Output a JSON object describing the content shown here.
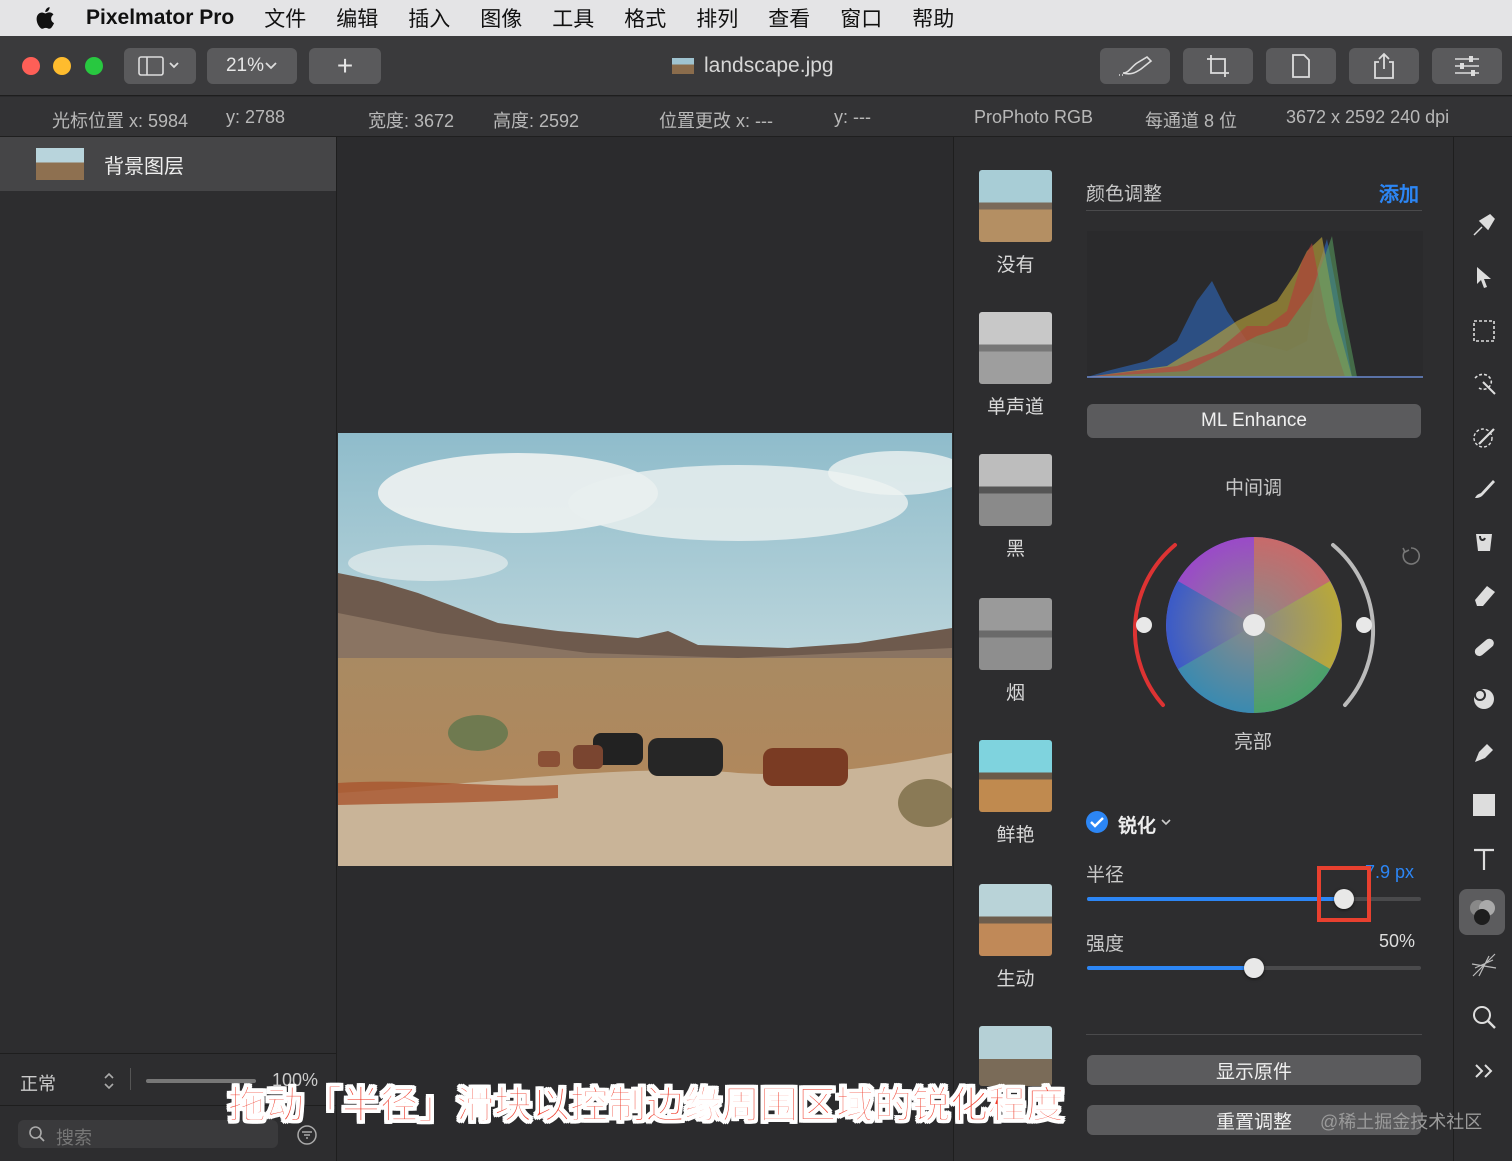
{
  "menubar": {
    "app_name": "Pixelmator Pro",
    "items": [
      "文件",
      "编辑",
      "插入",
      "图像",
      "工具",
      "格式",
      "排列",
      "查看",
      "窗口",
      "帮助"
    ]
  },
  "toolbar": {
    "zoom_label": "21%",
    "add_label": "+",
    "document_title": "landscape.jpg"
  },
  "infobar": {
    "cursor_x": "光标位置 x: 5984",
    "cursor_y": "y: 2788",
    "width": "宽度: 3672",
    "height": "高度: 2592",
    "pos_change_x": "位置更改 x: ---",
    "pos_change_y": "y: ---",
    "color_profile": "ProPhoto RGB",
    "bit_depth": "每通道 8 位",
    "dimensions": "3672 x 2592 240 dpi"
  },
  "layers": {
    "layer_name": "背景图层",
    "blend_mode": "正常",
    "opacity": "100%",
    "search_placeholder": "搜索"
  },
  "presets": [
    "没有",
    "单声道",
    "黑",
    "烟",
    "鲜艳",
    "生动"
  ],
  "adjustments": {
    "section_title": "颜色调整",
    "add_label": "添加",
    "ml_enhance_label": "ML Enhance",
    "midtones_label": "中间调",
    "highlights_label": "亮部",
    "sharpen_label": "锐化",
    "sharpen_enabled": true,
    "radius_label": "半径",
    "radius_value": "7.9 px",
    "radius_level": 0.77,
    "intensity_label": "强度",
    "intensity_value": "50%",
    "intensity_level": 0.5,
    "show_original_label": "显示原件",
    "reset_label": "重置调整"
  },
  "caption": "拖动「半径」滑块以控制边缘周围区域的锐化程度",
  "watermark": "@稀土掘金技术社区",
  "colors": {
    "accent": "#2c86f5",
    "highlight_box": "#e8402f",
    "caption": "#ef3b2a"
  }
}
